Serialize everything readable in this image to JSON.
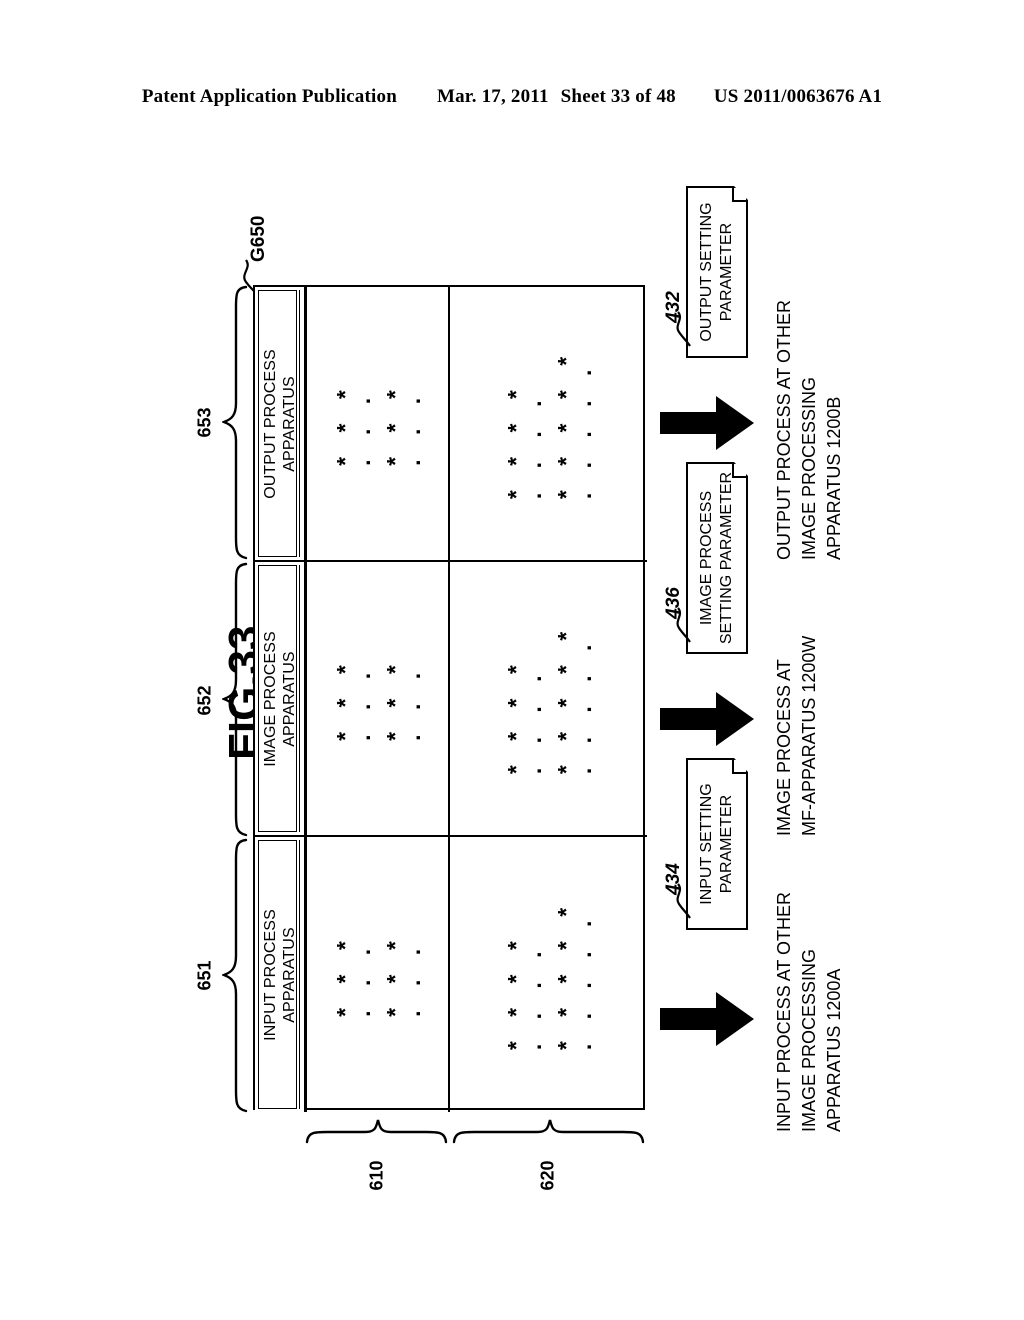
{
  "header": {
    "publication": "Patent Application Publication",
    "date": "Mar. 17, 2011",
    "sheet": "Sheet 33 of 48",
    "patent_number": "US 2011/0063676 A1"
  },
  "figure": {
    "title": "FIG.33",
    "table_callout": "G650",
    "rows": [
      {
        "ref": "653",
        "label_line1": "OUTPUT PROCESS",
        "label_line2": "APPARATUS"
      },
      {
        "ref": "652",
        "label_line1": "IMAGE PROCESS",
        "label_line2": "APPARATUS"
      },
      {
        "ref": "651",
        "label_line1": "INPUT PROCESS",
        "label_line2": "APPARATUS"
      }
    ],
    "columns": [
      {
        "ref": "610"
      },
      {
        "ref": "620"
      }
    ],
    "cell_pattern": {
      "col610": {
        "line1_stars": "* * *",
        "line1_dots": ". . .",
        "line2_stars": "* * *",
        "line2_dots": ". . ."
      },
      "col620": {
        "line1_stars": "* * * *",
        "line1_dots": ". . . .",
        "line2_stars": "* * * * *",
        "line2_dots": ". . . . ."
      }
    },
    "callouts": [
      {
        "ref": "432",
        "box_line1": "OUTPUT SETTING",
        "box_line2": "PARAMETER",
        "caption_line1": "OUTPUT PROCESS AT OTHER",
        "caption_line2": "IMAGE PROCESSING",
        "caption_line3": "APPARATUS 1200B"
      },
      {
        "ref": "436",
        "box_line1": "IMAGE PROCESS",
        "box_line2": "SETTING PARAMETER",
        "caption_line1": "IMAGE PROCESS AT",
        "caption_line2": "MF-APPARATUS 1200W",
        "caption_line3": ""
      },
      {
        "ref": "434",
        "box_line1": "INPUT SETTING",
        "box_line2": "PARAMETER",
        "caption_line1": "INPUT PROCESS AT OTHER",
        "caption_line2": "IMAGE PROCESSING",
        "caption_line3": "APPARATUS 1200A"
      }
    ]
  },
  "colors": {
    "ink": "#000000",
    "paper": "#ffffff"
  }
}
